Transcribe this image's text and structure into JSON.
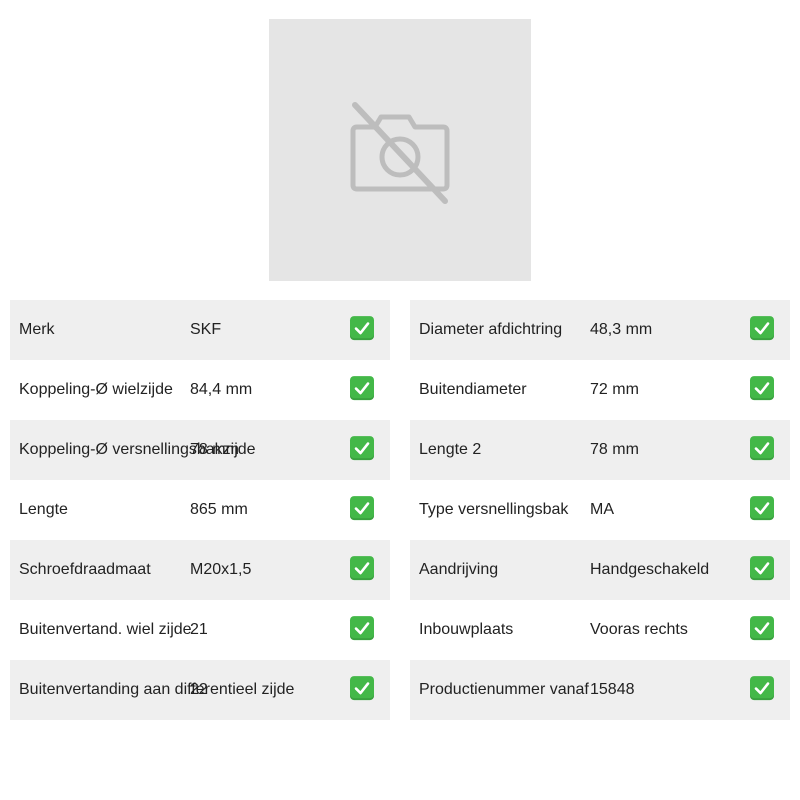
{
  "image": {
    "icon": "no-photo-icon"
  },
  "colors": {
    "check": "#43b848",
    "row_alt": "#efefef",
    "placeholder": "#e5e5e5"
  },
  "left_specs": [
    {
      "label": "Merk",
      "value": "SKF",
      "icon": "check-icon"
    },
    {
      "label": "Koppeling-Ø wielzijde",
      "value": "84,4 mm",
      "icon": "check-icon"
    },
    {
      "label": "Koppeling-Ø versnellingsbakzijde",
      "value": "78 mm",
      "icon": "check-icon"
    },
    {
      "label": "Lengte",
      "value": "865 mm",
      "icon": "check-icon"
    },
    {
      "label": "Schroefdraadmaat",
      "value": "M20x1,5",
      "icon": "check-icon"
    },
    {
      "label": "Buitenvertand. wiel zijde",
      "value": "21",
      "icon": "check-icon"
    },
    {
      "label": "Buitenvertanding aan differentieel zijde",
      "value": "22",
      "icon": "check-icon"
    }
  ],
  "right_specs": [
    {
      "label": "Diameter afdichtring",
      "value": "48,3 mm",
      "icon": "check-icon"
    },
    {
      "label": "Buitendiameter",
      "value": "72 mm",
      "icon": "check-icon"
    },
    {
      "label": "Lengte 2",
      "value": "78 mm",
      "icon": "check-icon"
    },
    {
      "label": "Type versnellingsbak",
      "value": "MA",
      "icon": "check-icon"
    },
    {
      "label": "Aandrijving",
      "value": "Handgeschakeld",
      "icon": "check-icon"
    },
    {
      "label": "Inbouwplaats",
      "value": "Vooras rechts",
      "icon": "check-icon"
    },
    {
      "label": "Productienummer vanaf",
      "value": "15848",
      "icon": "check-icon"
    }
  ]
}
